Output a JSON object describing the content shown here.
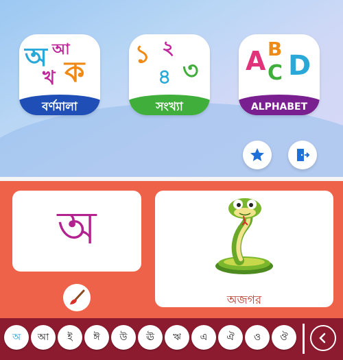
{
  "menu": {
    "tiles": [
      {
        "label": "বর্ণমালা",
        "ribbon_color": "#1f4fb6",
        "glyphs": [
          "অ",
          "আ",
          "খ",
          "ক"
        ]
      },
      {
        "label": "সংখ্যা",
        "ribbon_color": "#3fae3a",
        "glyphs": [
          "১",
          "২",
          "৪",
          "৩"
        ]
      },
      {
        "label": "ALPHABET",
        "ribbon_color": "#7a1f8f",
        "glyphs": [
          "A",
          "B",
          "C",
          "D"
        ]
      }
    ],
    "favorite_icon": "star-icon",
    "exit_icon": "exit-door-icon"
  },
  "lesson": {
    "current_letter": "অ",
    "word": "অজগর",
    "picture": "snake-illustration",
    "paint_icon": "paintbrush-icon"
  },
  "keyboard": {
    "letters": [
      "অ",
      "আ",
      "ই",
      "ঈ",
      "উ",
      "ঊ",
      "ঋ",
      "এ",
      "ঐ",
      "ও",
      "ঔ"
    ],
    "active_index": 0,
    "back_icon": "chevron-left-icon"
  },
  "colors": {
    "accent_red": "#ee6249",
    "bar_maroon": "#8c1b2f",
    "letter_magenta": "#b2238f"
  }
}
